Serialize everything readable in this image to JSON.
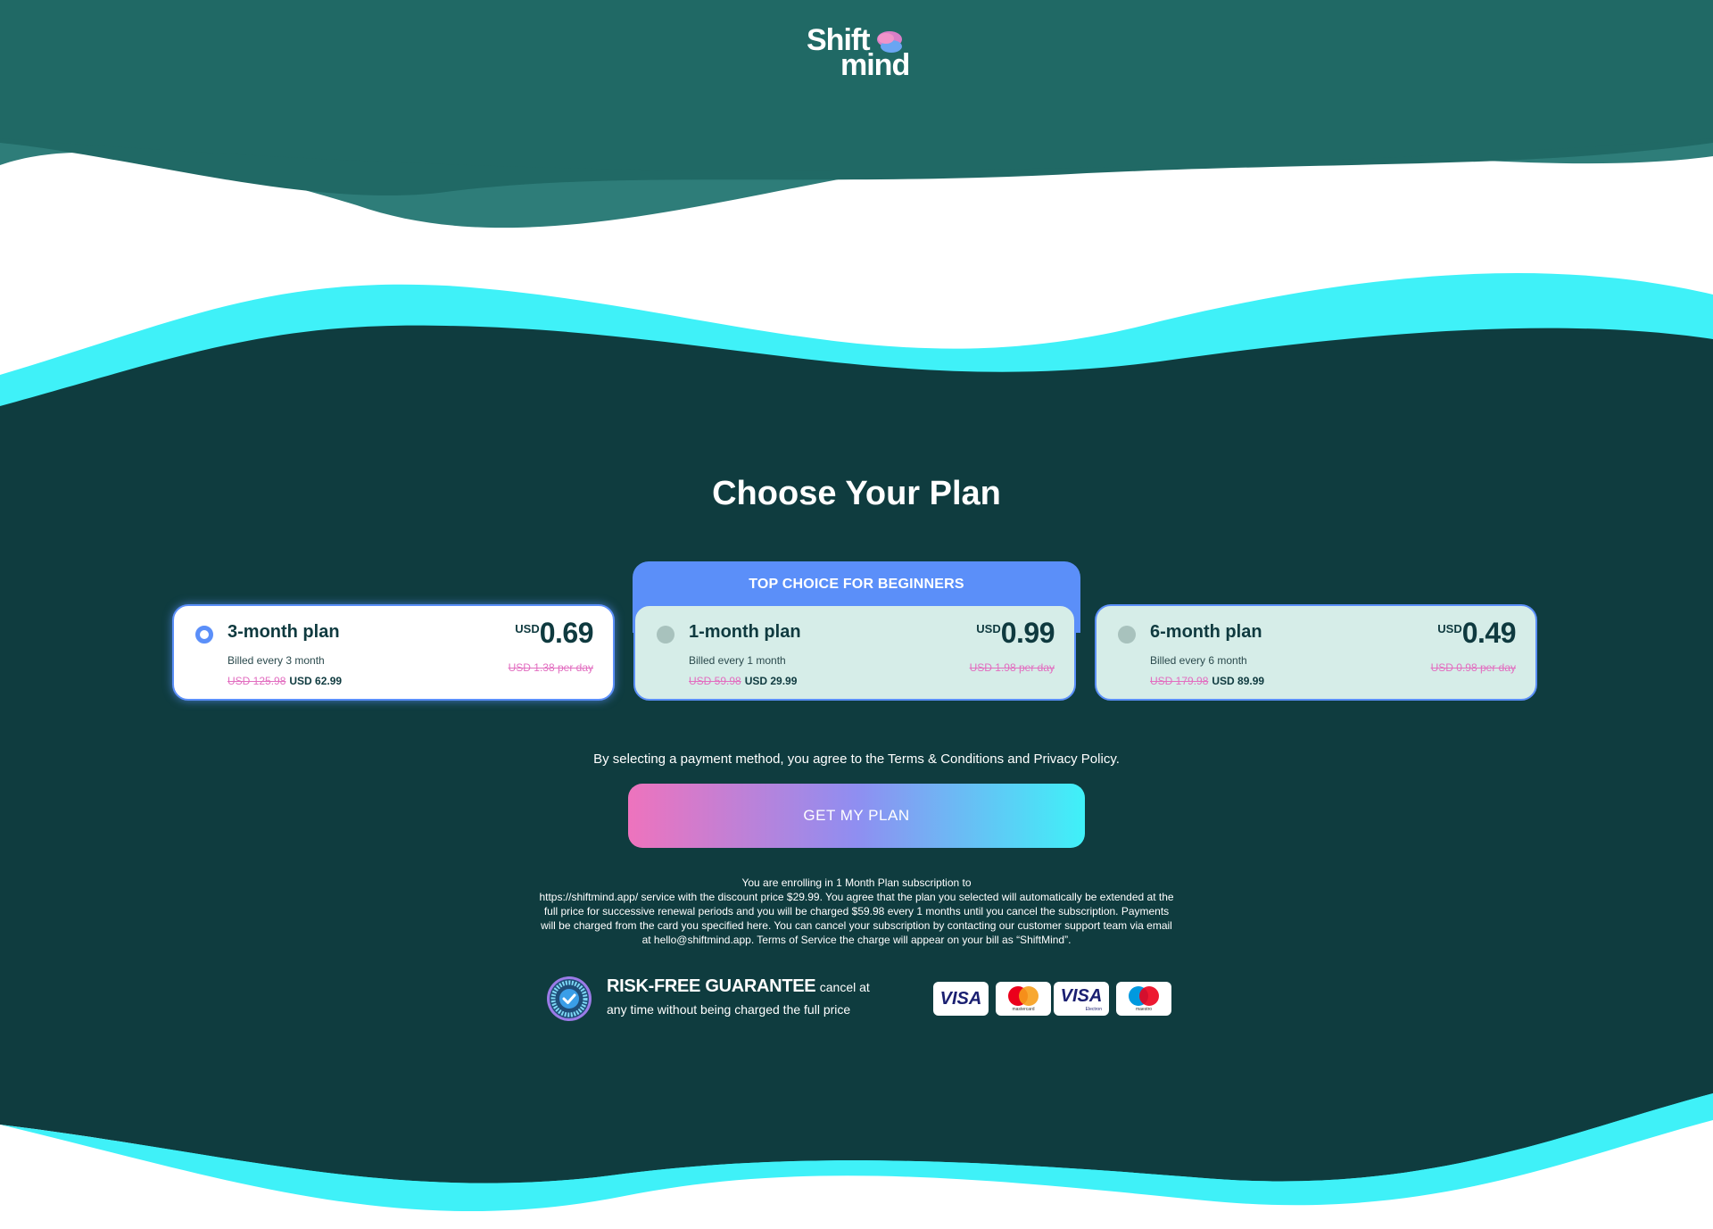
{
  "brand": {
    "logo_line1": "Shift",
    "logo_line2": "mind",
    "colors": {
      "header_teal": "#206965",
      "band_teal": "#2e7d79",
      "dark_teal": "#0f3c3f",
      "cyan": "#3ff1f8",
      "accent_blue": "#5b8ff9",
      "strike_pink": "#e26ec0"
    }
  },
  "page": {
    "title": "Choose Your Plan"
  },
  "badge_top": "TOP CHOICE FOR BEGINNERS",
  "plans": [
    {
      "name": "3-month plan",
      "billed": "Billed every 3 month",
      "old_total": "USD 125.98",
      "new_total": "USD 62.99",
      "currency": "USD",
      "per_day": "0.69",
      "old_per_day": "USD 1.38 per day",
      "selected": true
    },
    {
      "name": "1-month plan",
      "billed": "Billed every 1 month",
      "old_total": "USD 59.98",
      "new_total": "USD 29.99",
      "currency": "USD",
      "per_day": "0.99",
      "old_per_day": "USD 1.98 per day",
      "selected": false
    },
    {
      "name": "6-month plan",
      "billed": "Billed every 6 month",
      "old_total": "USD 179.98",
      "new_total": "USD 89.99",
      "currency": "USD",
      "per_day": "0.49",
      "old_per_day": "USD 0.98 per day",
      "selected": false
    }
  ],
  "agreement": "By selecting a payment method, you agree to the Terms & Conditions and Privacy Policy.",
  "cta_label": "GET MY PLAN",
  "legal": {
    "line1": "You are enrolling in 1 Month Plan subscription to",
    "line2": "https://shiftmind.app/ service with the discount price $29.99. You agree that the plan you selected will automatically be extended at the",
    "line3": "full price for successive renewal periods and you will be charged $59.98 every 1 months until you cancel the subscription. Payments",
    "line4": "will be charged from the card you specified here. You can cancel your subscription by contacting our customer support team via email",
    "line5": "at hello@shiftmind.app. Terms of Service the charge will appear on your bill as “ShiftMind”."
  },
  "guarantee": {
    "title": "RISK-FREE GUARANTEE",
    "text_part1": "cancel at",
    "text_part2": "any time without being charged the full price",
    "badge_text": "MONEYBACK GUARANTEE"
  },
  "payment_methods": [
    {
      "icon": "visa-icon",
      "label": "VISA"
    },
    {
      "icon": "mastercard-icon",
      "label": "mastercard"
    },
    {
      "icon": "visa-electron-icon",
      "label": "VISA",
      "sub": "Electron"
    },
    {
      "icon": "maestro-icon",
      "label": "maestro"
    }
  ]
}
